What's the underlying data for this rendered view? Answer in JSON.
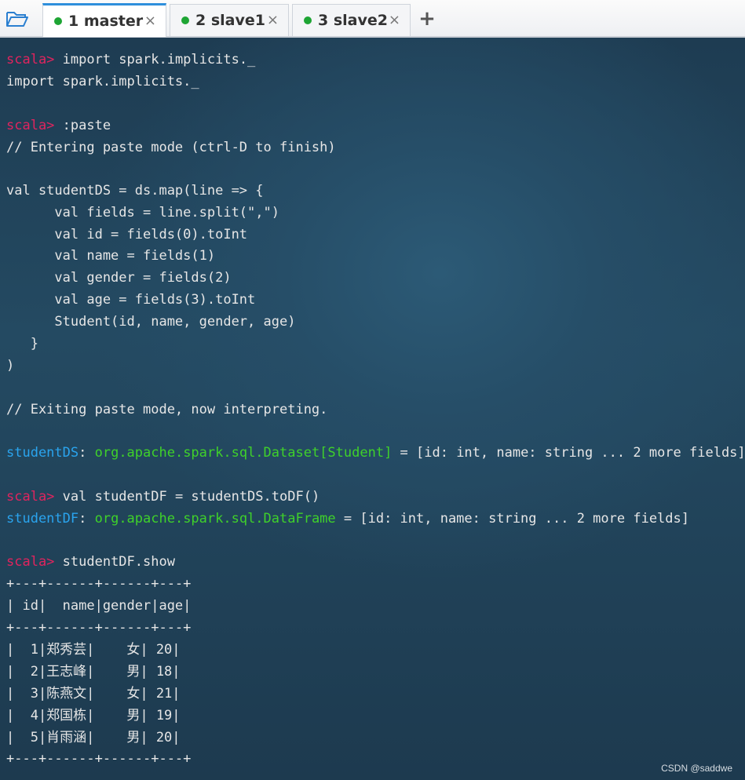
{
  "tabs": [
    {
      "label": "1 master",
      "close": "×",
      "active": true
    },
    {
      "label": "2 slave1",
      "close": "×",
      "active": false
    },
    {
      "label": "3 slave2",
      "close": "×",
      "active": false
    }
  ],
  "add_tab": "+",
  "icons": {
    "open": "folder-open-icon",
    "status": "connected-dot-icon"
  },
  "colors": {
    "prompt": "#e0245e",
    "type_name": "#3fd12a",
    "identifier": "#2aa4ee",
    "status_dot": "#1ea534"
  },
  "terminal": {
    "prompt": "scala>",
    "l1": " import spark.implicits._",
    "l2": "import spark.implicits._",
    "l3": " :paste",
    "l4": "// Entering paste mode (ctrl-D to finish)",
    "l5": "val studentDS = ds.map(line => {",
    "l6": "      val fields = line.split(\",\")",
    "l7": "      val id = fields(0).toInt",
    "l8": "      val name = fields(1)",
    "l9": "      val gender = fields(2)",
    "l10": "      val age = fields(3).toInt",
    "l11": "      Student(id, name, gender, age)",
    "l12": "   }",
    "l13": ")",
    "l14": "// Exiting paste mode, now interpreting.",
    "l15_name": "studentDS",
    "l15_colon": ": ",
    "l15_type": "org.apache.spark.sql.Dataset[Student]",
    "l15_rest": " = [id: int, name: string ... 2 more fields]",
    "l16": " val studentDF = studentDS.toDF()",
    "l17_name": "studentDF",
    "l17_colon": ": ",
    "l17_type": "org.apache.spark.sql.DataFrame",
    "l17_rest": " = [id: int, name: string ... 2 more fields]",
    "l18": " studentDF.show",
    "border": "+---+------+------+---+",
    "header": "| id|  name|gender|age|",
    "rows": [
      "|  1|郑秀芸|    女| 20|",
      "|  2|王志峰|    男| 18|",
      "|  3|陈燕文|    女| 21|",
      "|  4|郑国栋|    男| 19|",
      "|  5|肖雨涵|    男| 20|"
    ]
  },
  "watermark": "CSDN @saddwe"
}
